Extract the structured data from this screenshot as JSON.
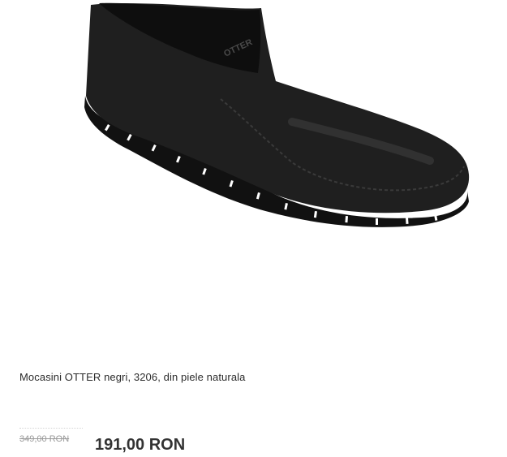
{
  "product": {
    "image_alt": "Black leather slip-on loafer shoe",
    "brand_mark": "OTTER",
    "title": "Mocasini OTTER negri, 3206, din piele naturala",
    "old_price": "349,00 RON",
    "new_price": "191,00 RON"
  },
  "colors": {
    "shoe": "#1c1c1c",
    "old_price": "#9a9a9a",
    "new_price": "#333333"
  }
}
